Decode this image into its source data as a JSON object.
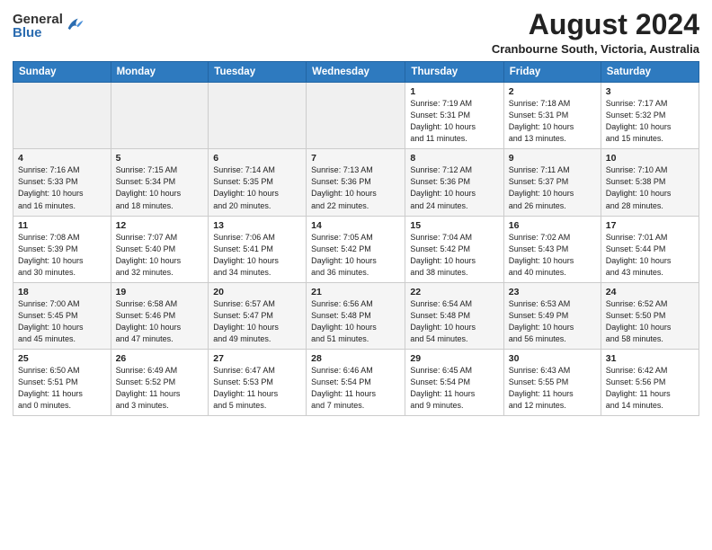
{
  "header": {
    "logo": {
      "general": "General",
      "blue": "Blue"
    },
    "title": "August 2024",
    "location": "Cranbourne South, Victoria, Australia"
  },
  "weekdays": [
    "Sunday",
    "Monday",
    "Tuesday",
    "Wednesday",
    "Thursday",
    "Friday",
    "Saturday"
  ],
  "weeks": [
    [
      {
        "day": "",
        "info": ""
      },
      {
        "day": "",
        "info": ""
      },
      {
        "day": "",
        "info": ""
      },
      {
        "day": "",
        "info": ""
      },
      {
        "day": "1",
        "info": "Sunrise: 7:19 AM\nSunset: 5:31 PM\nDaylight: 10 hours\nand 11 minutes."
      },
      {
        "day": "2",
        "info": "Sunrise: 7:18 AM\nSunset: 5:31 PM\nDaylight: 10 hours\nand 13 minutes."
      },
      {
        "day": "3",
        "info": "Sunrise: 7:17 AM\nSunset: 5:32 PM\nDaylight: 10 hours\nand 15 minutes."
      }
    ],
    [
      {
        "day": "4",
        "info": "Sunrise: 7:16 AM\nSunset: 5:33 PM\nDaylight: 10 hours\nand 16 minutes."
      },
      {
        "day": "5",
        "info": "Sunrise: 7:15 AM\nSunset: 5:34 PM\nDaylight: 10 hours\nand 18 minutes."
      },
      {
        "day": "6",
        "info": "Sunrise: 7:14 AM\nSunset: 5:35 PM\nDaylight: 10 hours\nand 20 minutes."
      },
      {
        "day": "7",
        "info": "Sunrise: 7:13 AM\nSunset: 5:36 PM\nDaylight: 10 hours\nand 22 minutes."
      },
      {
        "day": "8",
        "info": "Sunrise: 7:12 AM\nSunset: 5:36 PM\nDaylight: 10 hours\nand 24 minutes."
      },
      {
        "day": "9",
        "info": "Sunrise: 7:11 AM\nSunset: 5:37 PM\nDaylight: 10 hours\nand 26 minutes."
      },
      {
        "day": "10",
        "info": "Sunrise: 7:10 AM\nSunset: 5:38 PM\nDaylight: 10 hours\nand 28 minutes."
      }
    ],
    [
      {
        "day": "11",
        "info": "Sunrise: 7:08 AM\nSunset: 5:39 PM\nDaylight: 10 hours\nand 30 minutes."
      },
      {
        "day": "12",
        "info": "Sunrise: 7:07 AM\nSunset: 5:40 PM\nDaylight: 10 hours\nand 32 minutes."
      },
      {
        "day": "13",
        "info": "Sunrise: 7:06 AM\nSunset: 5:41 PM\nDaylight: 10 hours\nand 34 minutes."
      },
      {
        "day": "14",
        "info": "Sunrise: 7:05 AM\nSunset: 5:42 PM\nDaylight: 10 hours\nand 36 minutes."
      },
      {
        "day": "15",
        "info": "Sunrise: 7:04 AM\nSunset: 5:42 PM\nDaylight: 10 hours\nand 38 minutes."
      },
      {
        "day": "16",
        "info": "Sunrise: 7:02 AM\nSunset: 5:43 PM\nDaylight: 10 hours\nand 40 minutes."
      },
      {
        "day": "17",
        "info": "Sunrise: 7:01 AM\nSunset: 5:44 PM\nDaylight: 10 hours\nand 43 minutes."
      }
    ],
    [
      {
        "day": "18",
        "info": "Sunrise: 7:00 AM\nSunset: 5:45 PM\nDaylight: 10 hours\nand 45 minutes."
      },
      {
        "day": "19",
        "info": "Sunrise: 6:58 AM\nSunset: 5:46 PM\nDaylight: 10 hours\nand 47 minutes."
      },
      {
        "day": "20",
        "info": "Sunrise: 6:57 AM\nSunset: 5:47 PM\nDaylight: 10 hours\nand 49 minutes."
      },
      {
        "day": "21",
        "info": "Sunrise: 6:56 AM\nSunset: 5:48 PM\nDaylight: 10 hours\nand 51 minutes."
      },
      {
        "day": "22",
        "info": "Sunrise: 6:54 AM\nSunset: 5:48 PM\nDaylight: 10 hours\nand 54 minutes."
      },
      {
        "day": "23",
        "info": "Sunrise: 6:53 AM\nSunset: 5:49 PM\nDaylight: 10 hours\nand 56 minutes."
      },
      {
        "day": "24",
        "info": "Sunrise: 6:52 AM\nSunset: 5:50 PM\nDaylight: 10 hours\nand 58 minutes."
      }
    ],
    [
      {
        "day": "25",
        "info": "Sunrise: 6:50 AM\nSunset: 5:51 PM\nDaylight: 11 hours\nand 0 minutes."
      },
      {
        "day": "26",
        "info": "Sunrise: 6:49 AM\nSunset: 5:52 PM\nDaylight: 11 hours\nand 3 minutes."
      },
      {
        "day": "27",
        "info": "Sunrise: 6:47 AM\nSunset: 5:53 PM\nDaylight: 11 hours\nand 5 minutes."
      },
      {
        "day": "28",
        "info": "Sunrise: 6:46 AM\nSunset: 5:54 PM\nDaylight: 11 hours\nand 7 minutes."
      },
      {
        "day": "29",
        "info": "Sunrise: 6:45 AM\nSunset: 5:54 PM\nDaylight: 11 hours\nand 9 minutes."
      },
      {
        "day": "30",
        "info": "Sunrise: 6:43 AM\nSunset: 5:55 PM\nDaylight: 11 hours\nand 12 minutes."
      },
      {
        "day": "31",
        "info": "Sunrise: 6:42 AM\nSunset: 5:56 PM\nDaylight: 11 hours\nand 14 minutes."
      }
    ]
  ]
}
